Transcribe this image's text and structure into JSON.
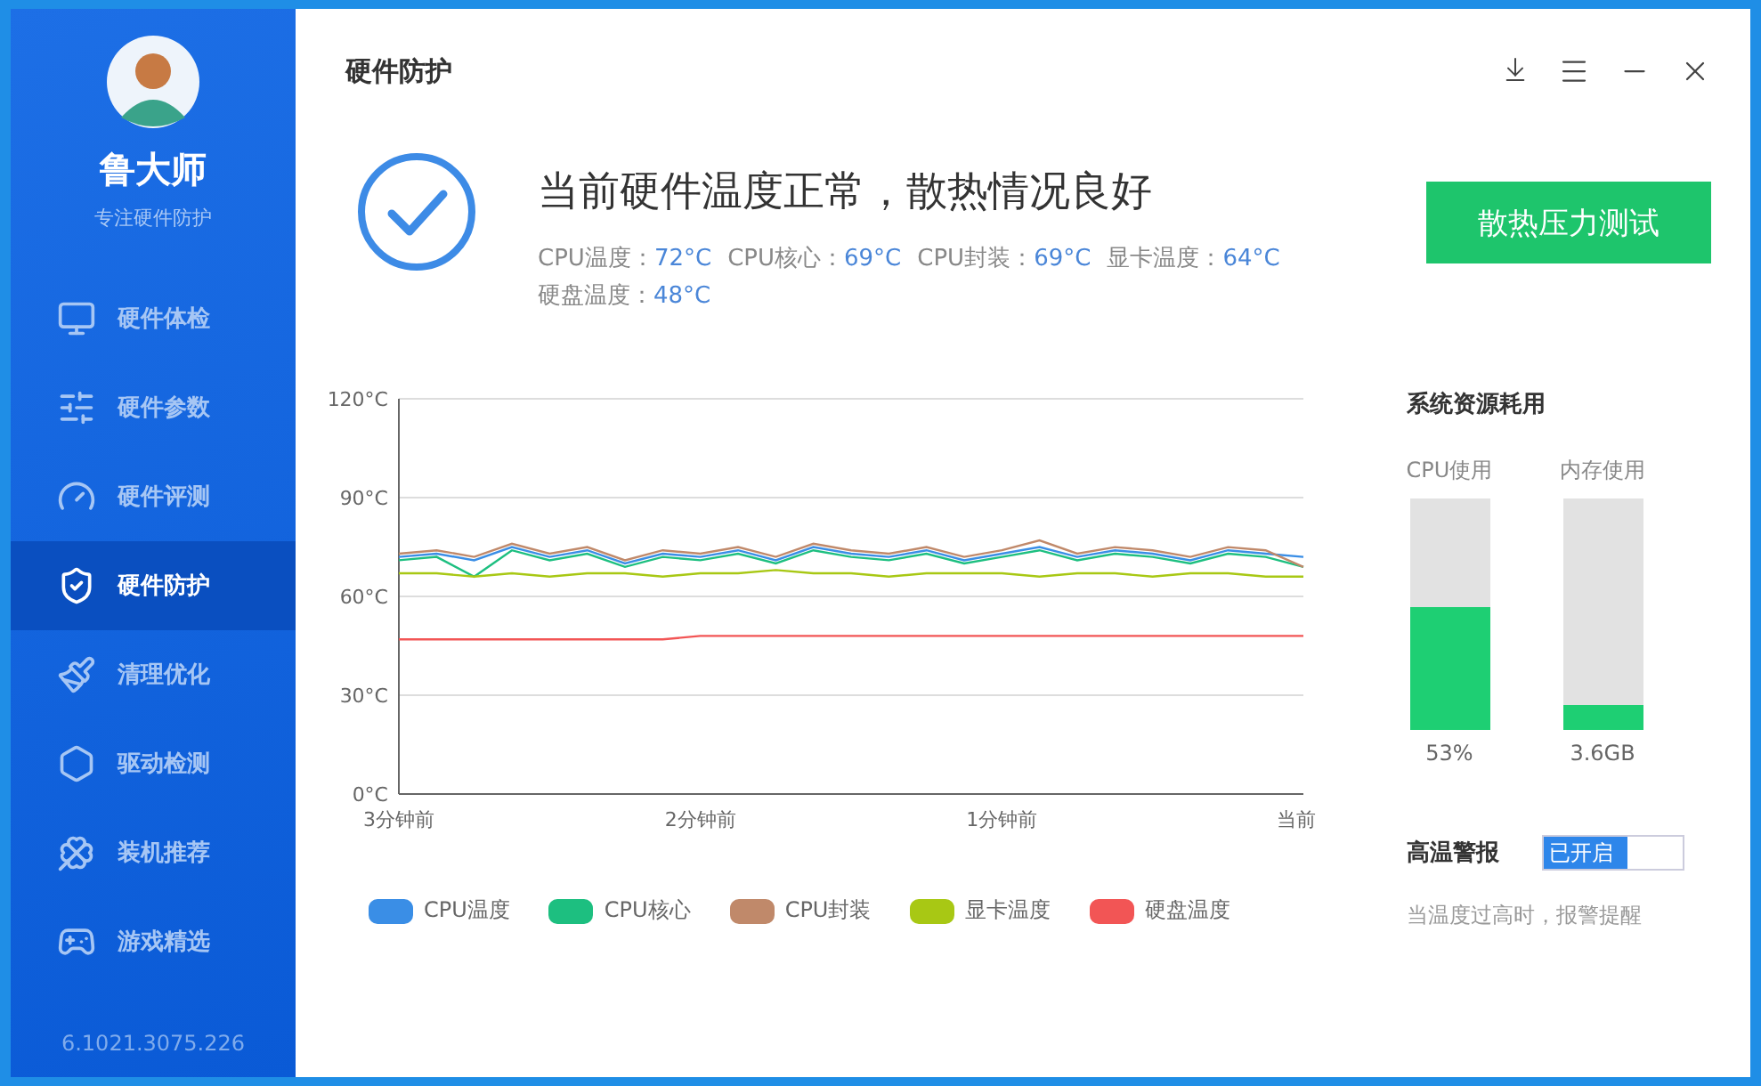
{
  "sidebar": {
    "app_name": "鲁大师",
    "tagline": "专注硬件防护",
    "items": [
      {
        "label": "硬件体检",
        "selected": false
      },
      {
        "label": "硬件参数",
        "selected": false
      },
      {
        "label": "硬件评测",
        "selected": false
      },
      {
        "label": "硬件防护",
        "selected": true
      },
      {
        "label": "清理优化",
        "selected": false
      },
      {
        "label": "驱动检测",
        "selected": false
      },
      {
        "label": "装机推荐",
        "selected": false
      },
      {
        "label": "游戏精选",
        "selected": false
      }
    ],
    "version": "6.1021.3075.226"
  },
  "header": {
    "title": "硬件防护"
  },
  "status": {
    "headline": "当前硬件温度正常，散热情况良好",
    "readings": [
      {
        "label": "CPU温度：",
        "value": "72°C"
      },
      {
        "label": "CPU核心：",
        "value": "69°C"
      },
      {
        "label": "CPU封装：",
        "value": "69°C"
      },
      {
        "label": "显卡温度：",
        "value": "64°C"
      },
      {
        "label": "硬盘温度：",
        "value": "48°C"
      }
    ],
    "button": "散热压力测试"
  },
  "chart": {
    "chart_data": {
      "type": "line",
      "grid": true,
      "categories": [
        "3分钟前",
        null,
        null,
        null,
        null,
        null,
        null,
        null,
        "2分钟前",
        null,
        null,
        null,
        null,
        null,
        null,
        null,
        "1分钟前",
        null,
        null,
        null,
        null,
        null,
        null,
        null,
        "当前"
      ],
      "ylim": [
        0,
        120
      ],
      "yticks": [
        {
          "value": 0,
          "label": "0°C"
        },
        {
          "value": 30,
          "label": "30°C"
        },
        {
          "value": 60,
          "label": "60°C"
        },
        {
          "value": 90,
          "label": "90°C"
        },
        {
          "value": 120,
          "label": "120°C"
        }
      ],
      "series": [
        {
          "name": "CPU温度",
          "color": "#3a8ee6",
          "values": [
            72,
            73,
            71,
            75,
            72,
            74,
            70,
            73,
            72,
            74,
            71,
            75,
            73,
            72,
            74,
            71,
            73,
            75,
            72,
            74,
            73,
            71,
            74,
            73,
            72
          ]
        },
        {
          "name": "CPU核心",
          "color": "#1dbf80",
          "values": [
            71,
            72,
            66,
            74,
            71,
            73,
            69,
            72,
            71,
            73,
            70,
            74,
            72,
            71,
            73,
            70,
            72,
            74,
            71,
            73,
            72,
            70,
            73,
            72,
            69
          ]
        },
        {
          "name": "CPU封装",
          "color": "#c0896a",
          "values": [
            73,
            74,
            72,
            76,
            73,
            75,
            71,
            74,
            73,
            75,
            72,
            76,
            74,
            73,
            75,
            72,
            74,
            77,
            73,
            75,
            74,
            72,
            75,
            74,
            69
          ]
        },
        {
          "name": "显卡温度",
          "color": "#a8c814",
          "values": [
            67,
            67,
            66,
            67,
            66,
            67,
            67,
            66,
            67,
            67,
            68,
            67,
            67,
            66,
            67,
            67,
            67,
            66,
            67,
            67,
            66,
            67,
            67,
            66,
            66
          ]
        },
        {
          "name": "硬盘温度",
          "color": "#f25555",
          "values": [
            47,
            47,
            47,
            47,
            47,
            47,
            47,
            47,
            48,
            48,
            48,
            48,
            48,
            48,
            48,
            48,
            48,
            48,
            48,
            48,
            48,
            48,
            48,
            48,
            48
          ]
        }
      ]
    }
  },
  "resources": {
    "title": "系统资源耗用",
    "meters": [
      {
        "label": "CPU使用",
        "level": 0.53,
        "reading": "53%"
      },
      {
        "label": "内存使用",
        "level": 0.11,
        "reading": "3.6GB"
      }
    ]
  },
  "alarm": {
    "label": "高温警报",
    "on": true,
    "toggle_text": "已开启",
    "hint": "当温度过高时，报警提醒"
  }
}
